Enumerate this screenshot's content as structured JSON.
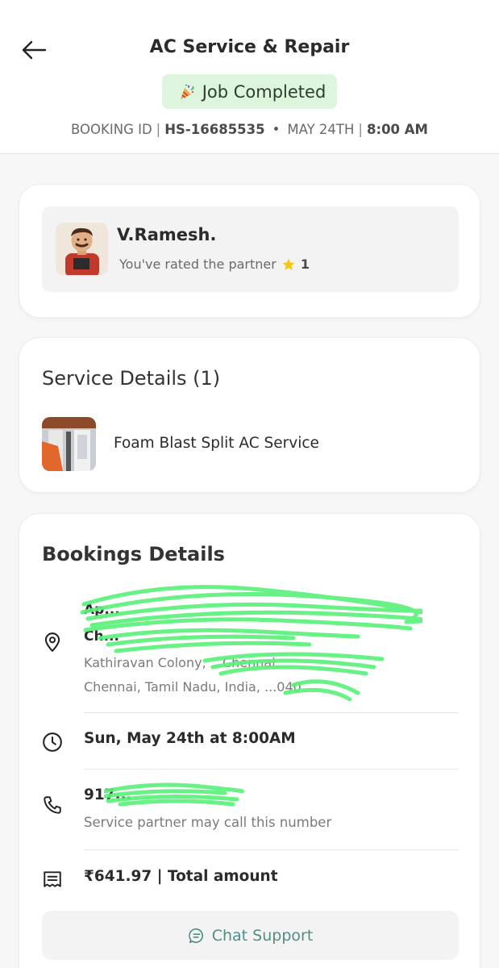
{
  "header": {
    "title": "AC Service & Repair",
    "status": "Job Completed",
    "status_icon": "party-popper-icon",
    "booking_label": "BOOKING ID",
    "booking_id": "HS-16685535",
    "date": "MAY 24TH",
    "time": "8:00 AM"
  },
  "partner": {
    "name": "V.Ramesh.",
    "rating_text": "You've rated the partner",
    "rating_value": "1"
  },
  "service_details": {
    "title": "Service Details (1)",
    "items": [
      {
        "name": "Foam Blast Split AC Service"
      }
    ]
  },
  "booking_details": {
    "title": "Bookings Details",
    "address_line1": "Ap...",
    "address_line2": "Ch...",
    "address_line3": "Kathiravan Colony, ...Chennai,",
    "address_line4": "Chennai, Tamil Nadu, India, ...040",
    "datetime": "Sun, May 24th at 8:00AM",
    "phone": "917...",
    "phone_note": "Service partner may call this number",
    "amount": "₹641.97",
    "amount_label": "Total amount"
  },
  "chat_support": {
    "label": "Chat Support"
  },
  "colors": {
    "accent": "#4f8e86",
    "status_bg": "#dcf5dc",
    "star": "#f5c518",
    "redaction": "#5cf07a"
  }
}
